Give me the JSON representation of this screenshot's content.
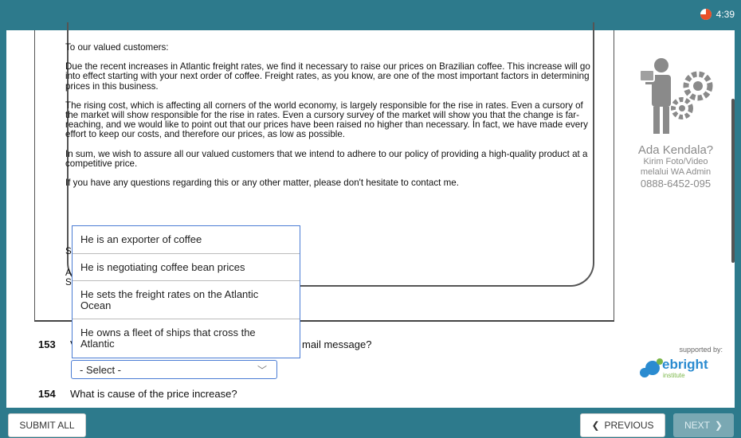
{
  "timer": {
    "value": "4:39"
  },
  "letter": {
    "greeting": "To our valued customers:",
    "paragraphs": [
      "Due the recent increases in Atlantic freight rates, we find it necessary to raise our prices on Brazilian coffee. This increase will go into effect starting with your next order of coffee. Freight rates, as you know, are one of the most important factors in determining prices in this business.",
      "The rising cost, which is affecting all corners of the world economy, is largely responsible for the rise in rates. Even a cursory of the market will show responsible for the rise in rates. Even a cursory survey of the market will show you that the change is far-reaching, and we would like to point out that our prices have been raised no higher than necessary. In fact, we have made every effort to keep our costs, and therefore our prices, as low as possible.",
      "In sum, we wish to assure all our valued customers that we intend to adhere to our policy of providing a high-quality product at a competitive price.",
      "If you have any questions regarding this or any other matter, please don't hesitate to contact me."
    ],
    "sign_fragments": [
      "S",
      "A",
      "S"
    ]
  },
  "side_help": {
    "line1": "Ada Kendala?",
    "line2": "Kirim Foto/Video",
    "line3": "melalui WA Admin",
    "line4": "0888-6452-095"
  },
  "questions": [
    {
      "number": "153",
      "text_start": "V",
      "text_end": "mail message?",
      "select_value": "- Select -"
    },
    {
      "number": "154",
      "text": "What is cause of the price increase?"
    }
  ],
  "dropdown_options": [
    "He is an exporter of coffee",
    "He is negotiating coffee bean prices",
    "He sets the freight rates on the Atlantic Ocean",
    "He owns a fleet of ships that cross the Atlantic"
  ],
  "brand": {
    "supported_by": "supported by:",
    "name": "ebright",
    "sub": "institute"
  },
  "buttons": {
    "submit": "SUBMIT ALL",
    "previous": "PREVIOUS",
    "next": "NEXT"
  },
  "colors": {
    "header": "#2d7a8c",
    "select_border": "#4a7cd4",
    "next_disabled": "#7aa8b3"
  }
}
